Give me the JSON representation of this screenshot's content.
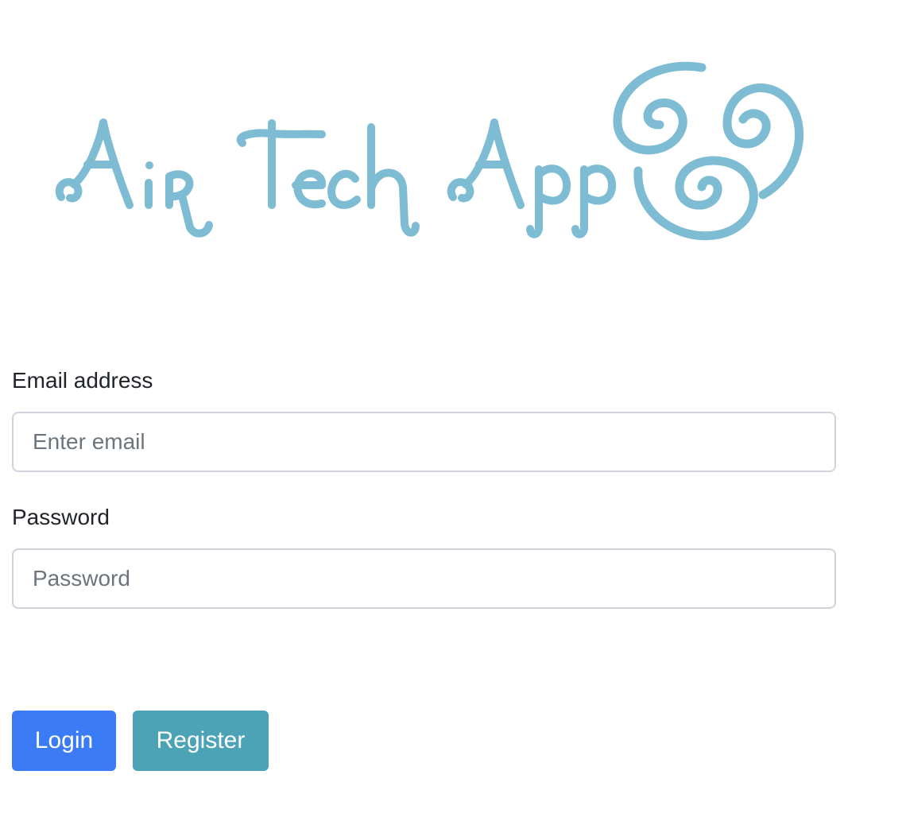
{
  "logo": {
    "text": "Air Tech App",
    "color": "#7dbcd3",
    "icon": "air-swirl-icon"
  },
  "form": {
    "email": {
      "label": "Email address",
      "placeholder": "Enter email",
      "value": ""
    },
    "password": {
      "label": "Password",
      "placeholder": "Password",
      "value": ""
    }
  },
  "buttons": {
    "login_label": "Login",
    "register_label": "Register"
  },
  "colors": {
    "login_button": "#3b7cf6",
    "register_button": "#4ba3b5",
    "input_border": "#ced4da",
    "placeholder": "#6c757d"
  }
}
